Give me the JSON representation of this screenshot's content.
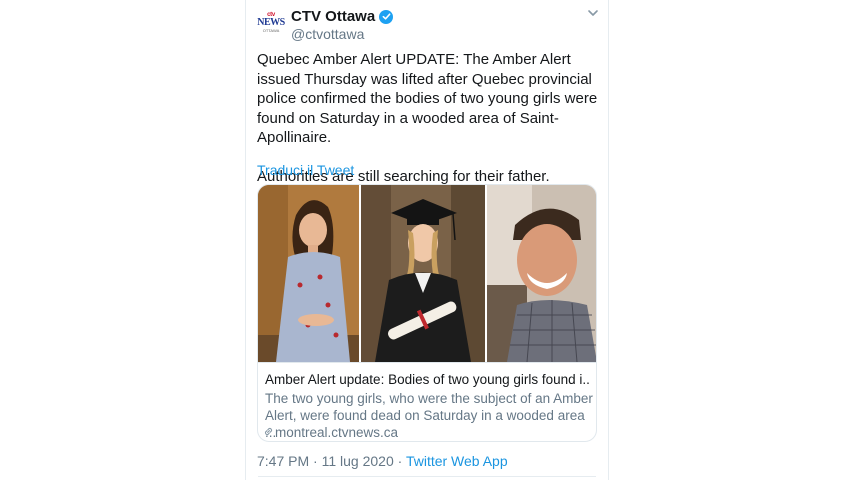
{
  "author": {
    "display_name": "CTV Ottawa",
    "handle": "@ctvottawa",
    "avatar_logo_top": "ctv",
    "avatar_logo_mid": "NEWS",
    "avatar_logo_bottom": "OTTAWA",
    "verified": true
  },
  "tweet": {
    "paragraphs": [
      "Quebec Amber Alert UPDATE: The Amber Alert issued Thursday was lifted after Quebec provincial police confirmed the bodies of two young girls were found on Saturday in a wooded area of Saint-Apollinaire.",
      "Authorities are still searching for their father."
    ],
    "translate_label": "Traduci il Tweet"
  },
  "card": {
    "title": "Amber Alert update: Bodies of two young girls found i...",
    "description": "The two young girls, who were the subject of an Amber Alert, were found dead on Saturday in a wooded area ...",
    "domain": "montreal.ctvnews.ca"
  },
  "meta": {
    "time": "7:47 PM",
    "separator_1": " · ",
    "date": "11 lug 2020",
    "separator_2": " · ",
    "source": "Twitter Web App"
  },
  "colors": {
    "link": "#1b95e0",
    "verified": "#1da1f2",
    "secondary_text": "#657786"
  }
}
